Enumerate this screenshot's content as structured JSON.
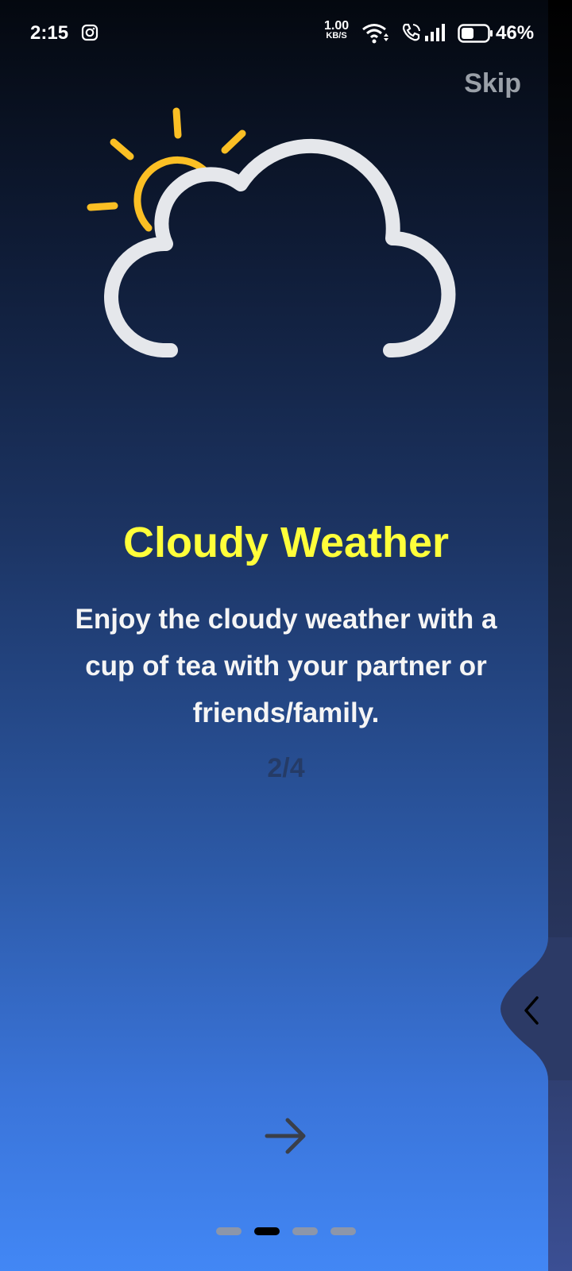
{
  "status": {
    "time": "2:15",
    "net_speed_value": "1.00",
    "net_speed_unit": "KB/S",
    "battery": "46%"
  },
  "skip_label": "Skip",
  "title": "Cloudy Weather",
  "description": "Enjoy the cloudy weather with a cup of tea with your partner or friends/family.",
  "page_indicator": "2/4",
  "pager": {
    "total": 4,
    "current": 2
  },
  "colors": {
    "title": "#ffff3a",
    "sun": "#fbbf24",
    "cloud": "#e5e7eb",
    "dot_active": "#000000",
    "dot_inactive": "#8c96aa"
  }
}
